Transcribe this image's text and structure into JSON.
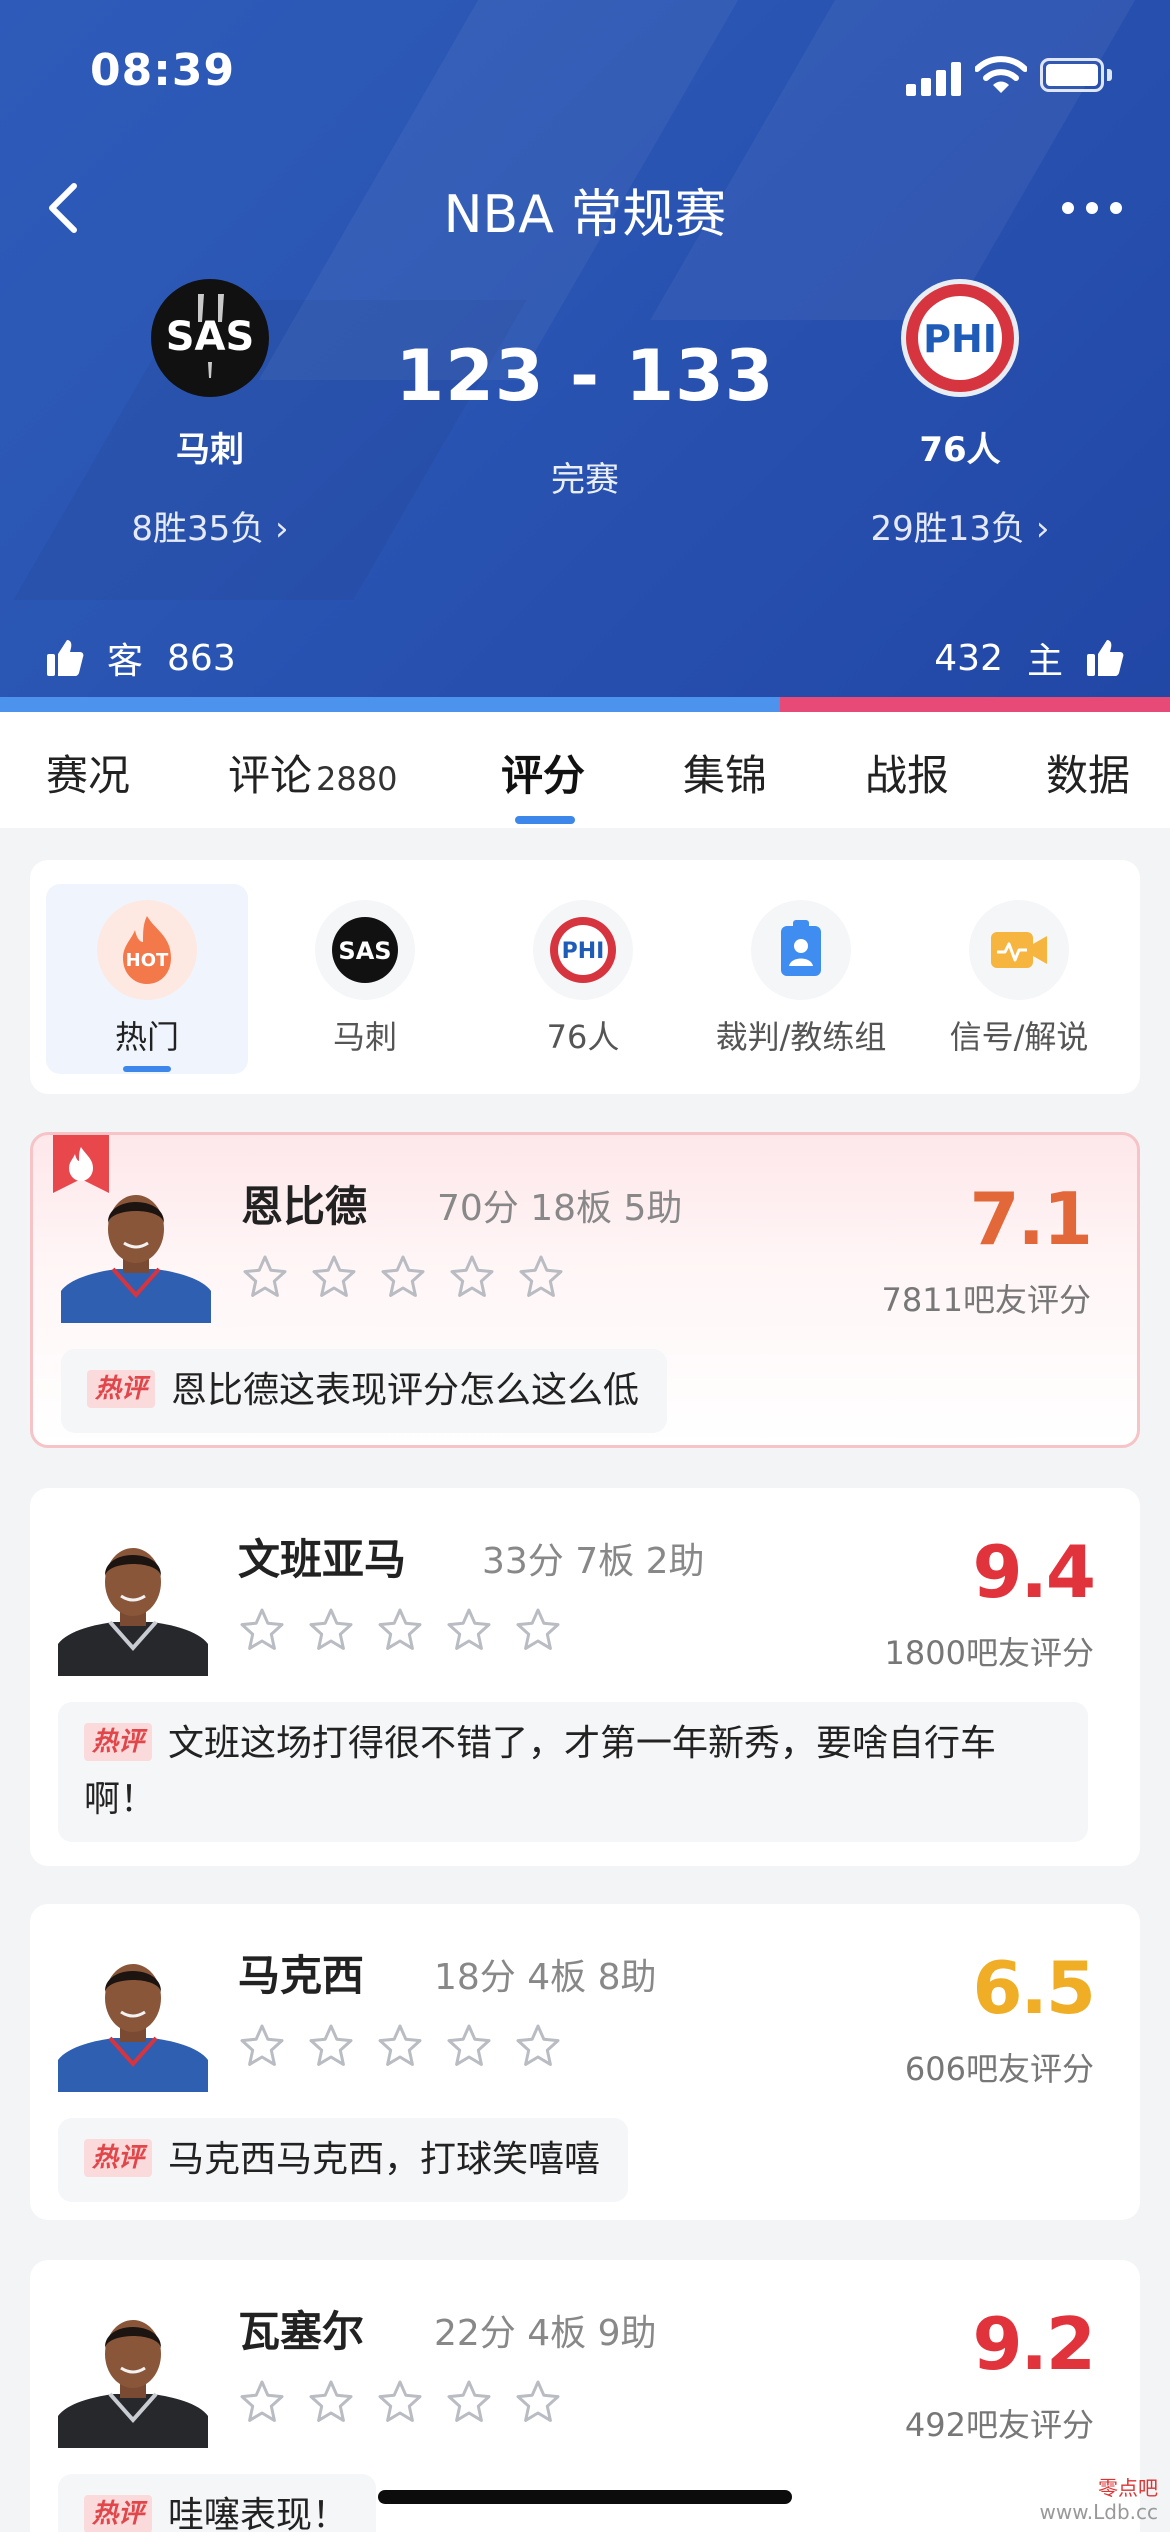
{
  "status_bar": {
    "time": "08:39"
  },
  "header": {
    "title": "NBA 常规赛",
    "away_team": {
      "logo_text": "SAS",
      "name": "马刺",
      "record": "8胜35负",
      "record_arrow": "›"
    },
    "home_team": {
      "logo_text": "PHI",
      "name": "76人",
      "record": "29胜13负",
      "record_arrow": "›"
    },
    "score": "123 - 133",
    "game_status": "完赛",
    "vote_away": {
      "label": "客",
      "count": "863"
    },
    "vote_home": {
      "label": "主",
      "count": "432"
    },
    "vote_away_share": 0.667
  },
  "tabs": [
    {
      "label": "赛况"
    },
    {
      "label": "评论",
      "count": "2880"
    },
    {
      "label": "评分",
      "active": true
    },
    {
      "label": "集锦"
    },
    {
      "label": "战报"
    },
    {
      "label": "数据"
    }
  ],
  "filters": [
    {
      "label": "热门",
      "icon": "hot-icon",
      "icon_text": "HOT",
      "active": true
    },
    {
      "label": "马刺",
      "icon": "spurs-logo-icon",
      "icon_text": "SAS"
    },
    {
      "label": "76人",
      "icon": "sixers-logo-icon",
      "icon_text": "PHI"
    },
    {
      "label": "裁判/教练组",
      "icon": "referee-badge-icon"
    },
    {
      "label": "信号/解说",
      "icon": "camera-signal-icon"
    }
  ],
  "players": [
    {
      "name": "恩比德",
      "stats": "70分 18板 5助",
      "score": "7.1",
      "score_color": "#e2683a",
      "raters": "7811吧友评分",
      "comment_tag": "热评",
      "comment": "恩比德这表现评分怎么这么低",
      "hot": true,
      "jersey": "sixers"
    },
    {
      "name": "文班亚马",
      "stats": "33分 7板 2助",
      "score": "9.4",
      "score_color": "#e0333c",
      "raters": "1800吧友评分",
      "comment_tag": "热评",
      "comment": "文班这场打得很不错了，才第一年新秀，要啥自行车啊！",
      "hot": false,
      "jersey": "spurs"
    },
    {
      "name": "马克西",
      "stats": "18分 4板 8助",
      "score": "6.5",
      "score_color": "#f0ae27",
      "raters": "606吧友评分",
      "comment_tag": "热评",
      "comment": "马克西马克西，打球笑嘻嘻",
      "hot": false,
      "jersey": "sixers"
    },
    {
      "name": "瓦塞尔",
      "stats": "22分 4板 9助",
      "score": "9.2",
      "score_color": "#e0333c",
      "raters": "492吧友评分",
      "comment_tag": "热评",
      "comment": "哇噻表现！",
      "hot": false,
      "jersey": "spurs"
    }
  ],
  "watermark": {
    "line1": "零点吧",
    "line2": "www.Ldb.cc"
  },
  "colors": {
    "header_blue": "#2a55b3",
    "accent_blue": "#3d86ea",
    "home_pink": "#e84a78",
    "away_blue": "#4b93ec",
    "hot_red": "#e0464a"
  }
}
